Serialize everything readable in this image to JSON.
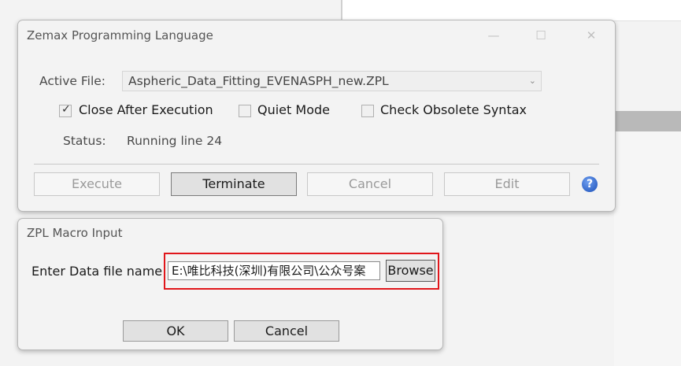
{
  "zpl_dialog": {
    "title": "Zemax Programming Language",
    "window_controls": {
      "minimize": "—",
      "maximize": "☐",
      "close": "✕"
    },
    "active_file_label": "Active File:",
    "active_file_value": "Aspheric_Data_Fitting_EVENASPH_new.ZPL",
    "options": [
      {
        "label": "Close After Execution",
        "checked": true
      },
      {
        "label": "Quiet Mode",
        "checked": false
      },
      {
        "label": "Check Obsolete Syntax",
        "checked": false
      }
    ],
    "status_label": "Status:",
    "status_value": "Running line 24",
    "buttons": {
      "execute": "Execute",
      "terminate": "Terminate",
      "cancel": "Cancel",
      "edit": "Edit"
    },
    "help_icon_glyph": "?"
  },
  "macro_dialog": {
    "title": "ZPL Macro Input",
    "prompt_label": "Enter Data file name:",
    "file_value": "E:\\唯比科技(深圳)有限公司\\公众号案",
    "browse_label": "Browse",
    "ok_label": "OK",
    "cancel_label": "Cancel"
  },
  "highlight_color": "#e0161b",
  "icons": [
    "check-mark-icon",
    "dropdown-chevron-icon",
    "help-icon",
    "minimize-icon",
    "maximize-icon",
    "close-icon"
  ]
}
